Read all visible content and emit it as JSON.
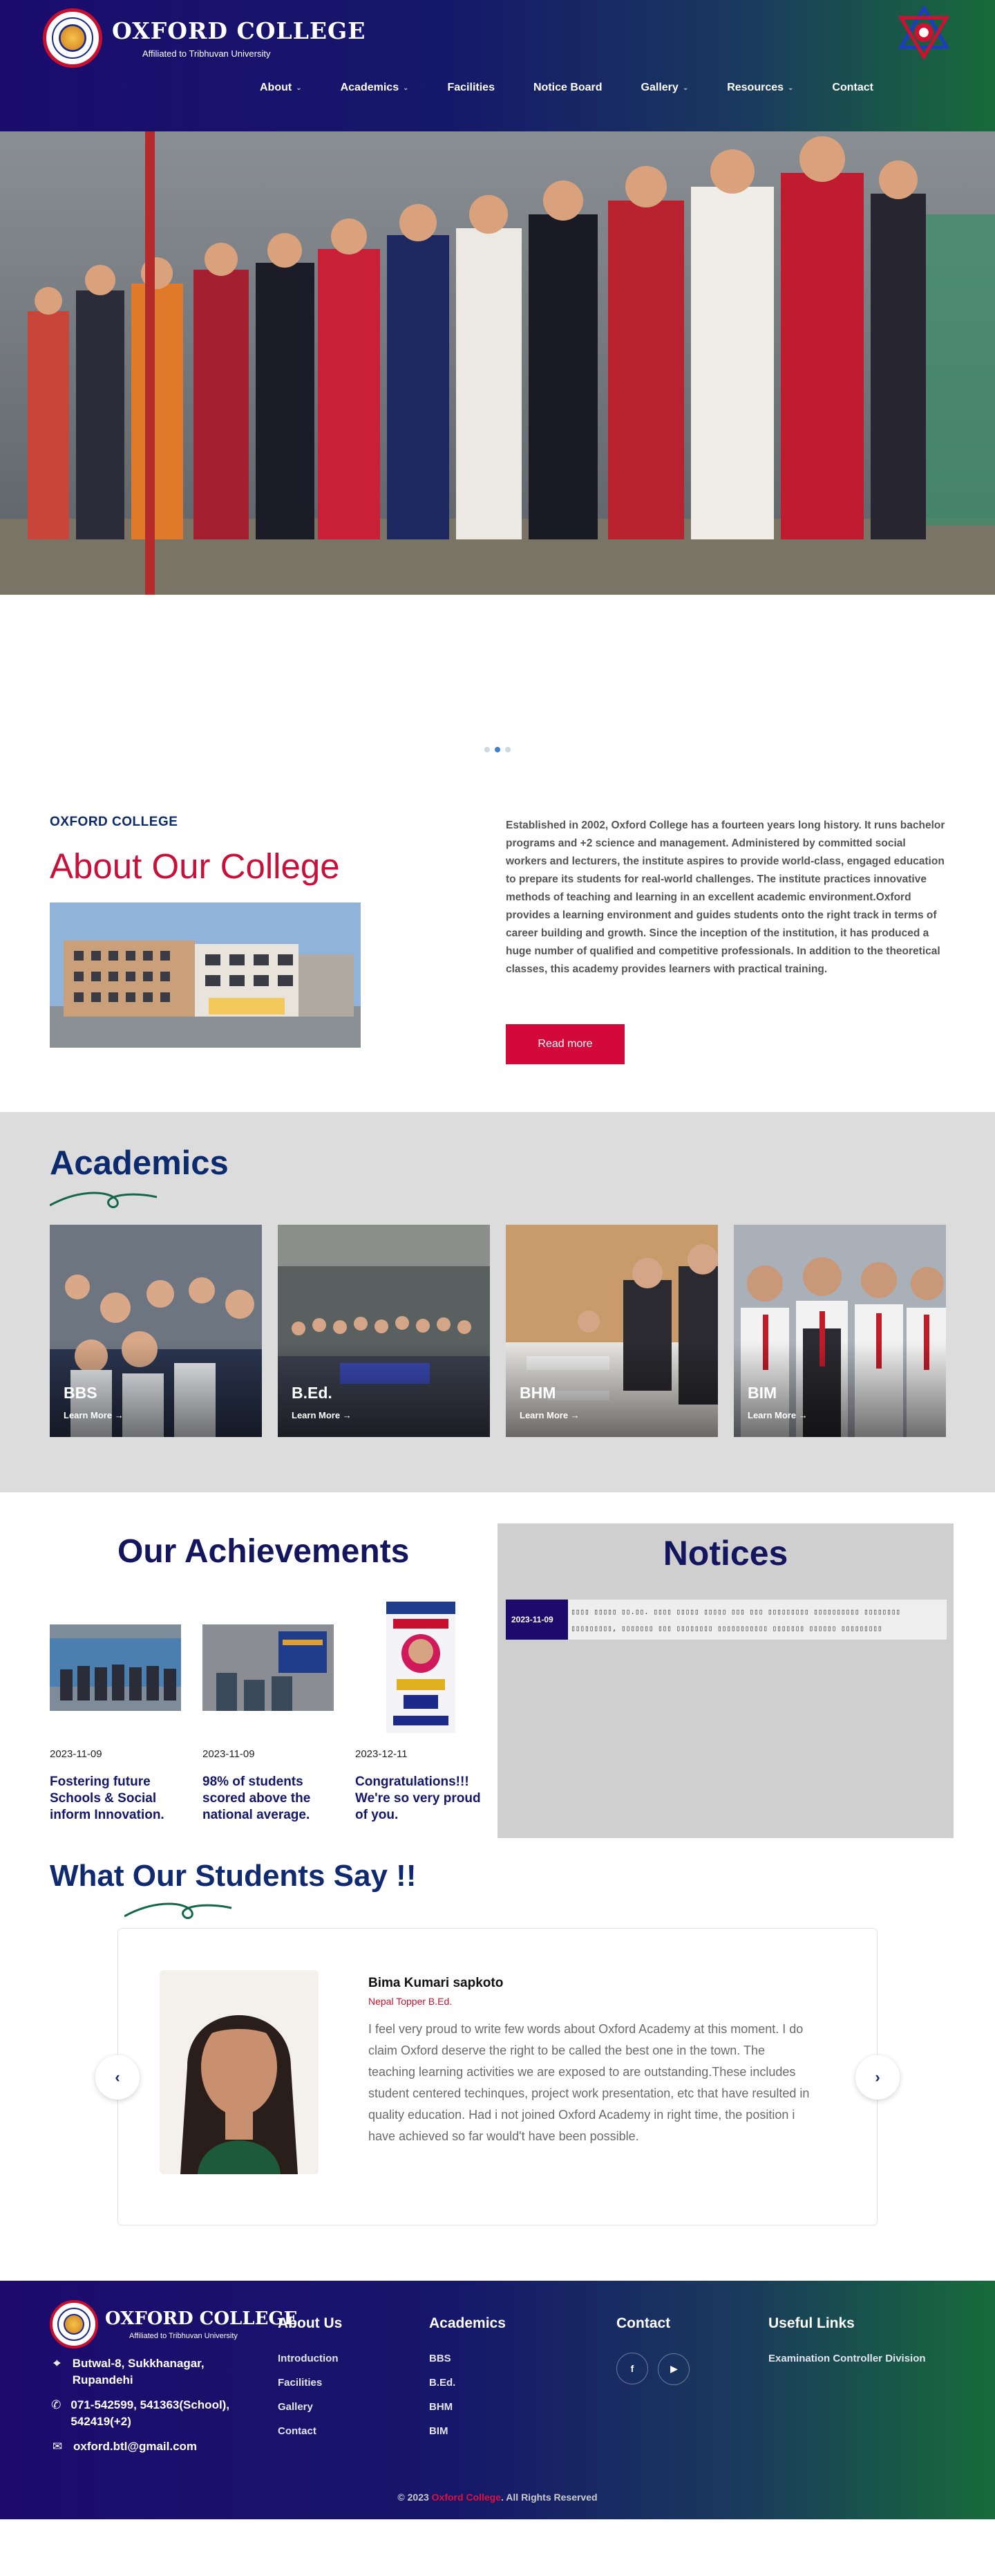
{
  "header": {
    "college_name": "OXFORD COLLEGE",
    "affiliation": "Affiliated to Tribhuvan University",
    "nav": [
      {
        "label": "About",
        "dropdown": true
      },
      {
        "label": "Academics",
        "dropdown": true
      },
      {
        "label": "Facilities",
        "dropdown": false
      },
      {
        "label": "Notice Board",
        "dropdown": false
      },
      {
        "label": "Gallery",
        "dropdown": true
      },
      {
        "label": "Resources",
        "dropdown": true
      },
      {
        "label": "Contact",
        "dropdown": false
      }
    ]
  },
  "hero": {
    "slide_count": 3,
    "active_slide": 2
  },
  "about": {
    "kicker": "OXFORD COLLEGE",
    "title": "About Our College",
    "body": "Established in 2002, Oxford College has a fourteen years long history. It runs bachelor programs and +2 science and management. Administered by committed social workers and lecturers, the institute aspires to provide world-class, engaged education to prepare its students for real-world challenges. The institute practices innovative methods of teaching and learning in an excellent academic environment.Oxford provides a learning environment and guides students onto the right track in terms of career building and growth. Since the inception of the institution, it has produced a huge number of qualified and competitive professionals. In addition to the theoretical classes, this academy provides learners with practical training.",
    "button": "Read more"
  },
  "academics": {
    "title": "Academics",
    "cards": [
      {
        "label": "BBS",
        "link": "Learn More"
      },
      {
        "label": "B.Ed.",
        "link": "Learn More"
      },
      {
        "label": "BHM",
        "link": "Learn More"
      },
      {
        "label": "BIM",
        "link": "Learn More"
      }
    ]
  },
  "achievements": {
    "title": "Our Achievements",
    "items": [
      {
        "date": "2023-11-09",
        "text": "Fostering future Schools & Social inform Innovation."
      },
      {
        "date": "2023-11-09",
        "text": "98% of students scored above the national average."
      },
      {
        "date": "2023-12-11",
        "text": "Congratulations!!! We're so very proud of you."
      }
    ]
  },
  "notices": {
    "title": "Notices",
    "items": [
      {
        "date": "2023-11-09",
        "text": "▯▯▯▯ ▯▯▯▯▯ ▯▯.▯▯. ▯▯▯▯ ▯▯▯▯▯ ▯▯▯▯▯ ▯▯▯ ▯▯▯ ▯▯▯▯▯▯▯▯▯ ▯▯▯▯▯▯▯▯▯▯ ▯▯▯▯▯▯▯▯ ▯▯▯▯▯▯▯▯▯, ▯▯▯▯▯▯▯ ▯▯▯ ▯▯▯▯▯▯▯▯ ▯▯▯▯▯▯▯▯▯▯▯ ▯▯▯▯▯▯▯ ▯▯▯▯▯▯ ▯▯▯▯▯▯▯▯▯"
      }
    ]
  },
  "testimonials": {
    "title": "What Our Students Say !!",
    "items": [
      {
        "name": "Bima Kumari sapkoto",
        "role": "Nepal Topper B.Ed.",
        "quote": "I feel very proud to write few words about Oxford Academy at this moment. I do claim Oxford deserve the right to be called the best one in the town. The teaching learning activities we are exposed to are outstanding.These includes student centered techinques, project work presentation, etc that have resulted in quality education. Had i not joined Oxford Academy in right time, the position i have achieved so far would't have been possible."
      }
    ],
    "prev": "‹",
    "next": "›"
  },
  "footer": {
    "college_name": "OXFORD COLLEGE",
    "affiliation": "Affiliated to Tribhuvan University",
    "address": "Butwal-8, Sukkhanagar, Rupandehi",
    "phone": "071-542599, 541363(School), 542419(+2)",
    "email": "oxford.btl@gmail.com",
    "about_title": "About Us",
    "about_links": [
      "Introduction",
      "Facilities",
      "Gallery",
      "Contact"
    ],
    "academics_title": "Academics",
    "academics_links": [
      "BBS",
      "B.Ed.",
      "BHM",
      "BIM"
    ],
    "contact_title": "Contact",
    "social": [
      "f",
      "▶"
    ],
    "useful_title": "Useful Links",
    "useful_links": [
      "Examination Controller Division"
    ],
    "copyright_prefix": "© 2023",
    "copyright_brand": "Oxford College",
    "copyright_suffix": ". All Rights Reserved"
  },
  "colors": {
    "navy": "#13155e",
    "crimson": "#c8103a",
    "academics_bg": "#dcdcdc",
    "notices_bg": "#cfcfcf"
  }
}
